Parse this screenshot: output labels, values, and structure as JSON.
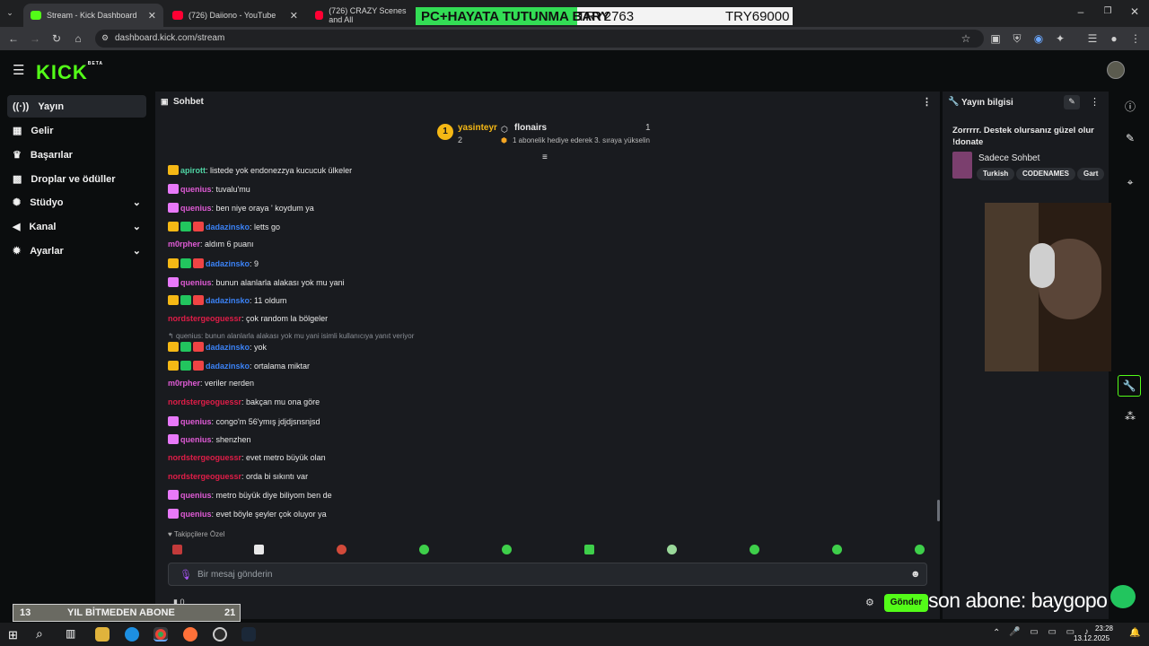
{
  "browser": {
    "tabs": [
      {
        "title": "Stream - Kick Dashboard",
        "active": true,
        "icon": "kick-icon"
      },
      {
        "title": "(726) Daiiono - YouTube",
        "active": false,
        "icon": "youtube-icon"
      },
      {
        "title": "(726) CRAZY Scenes and All",
        "active": false,
        "icon": "youtube-icon"
      }
    ],
    "url": "dashboard.kick.com/stream"
  },
  "donation_overlay": {
    "left_text": "PC+HAYATA TUTUNMA BARY",
    "mid_text": "TRY2763",
    "right_text": "TRY69000"
  },
  "header": {
    "logo": "KICK",
    "logo_sup": "BETA"
  },
  "sidebar": {
    "items": [
      {
        "label": "Yayın",
        "icon": "broadcast-icon",
        "active": true
      },
      {
        "label": "Gelir",
        "icon": "revenue-icon"
      },
      {
        "label": "Başarılar",
        "icon": "trophy-icon"
      },
      {
        "label": "Droplar ve ödüller",
        "icon": "gift-icon"
      },
      {
        "label": "Stüdyo",
        "icon": "gear-icon",
        "expandable": true
      },
      {
        "label": "Kanal",
        "icon": "megaphone-icon",
        "expandable": true
      },
      {
        "label": "Ayarlar",
        "icon": "settings-icon",
        "expandable": true
      }
    ]
  },
  "chat": {
    "title": "Sohbet",
    "pinned": {
      "rank": "1",
      "user1": "yasinteyr",
      "user1_count": "2",
      "user2": "flonairs",
      "user2_count": "1",
      "hint": "1 abonelik hediye ederek 3. sıraya yükselin"
    },
    "messages": [
      {
        "user": "apirott",
        "text": ": listede yok endonezzya kucucuk ülkeler",
        "color": "#4fd4a4"
      },
      {
        "user": "quenius",
        "text": ": tuvalu'mu",
        "color": "#e05bd6"
      },
      {
        "user": "quenius",
        "text": ": ben niye oraya ' koydum ya",
        "color": "#e05bd6"
      },
      {
        "user": "dadazinsko",
        "text": ": letts go",
        "color": "#3b82f6"
      },
      {
        "user": "m0rpher",
        "text": ": aldım 6 puanı",
        "color": "#e05bd6"
      },
      {
        "user": "dadazinsko",
        "text": ": 9",
        "color": "#3b82f6"
      },
      {
        "user": "quenius",
        "text": ": bunun alanlarla alakası yok mu yani",
        "color": "#e05bd6"
      },
      {
        "user": "dadazinsko",
        "text": ": 11 oldum",
        "color": "#3b82f6"
      },
      {
        "user": "nordstergeoguessr",
        "text": ": çok random la bölgeler",
        "color": "#e11d48"
      },
      {
        "user": "dadazinsko",
        "text": ": yok",
        "color": "#3b82f6"
      },
      {
        "user": "dadazinsko",
        "text": ": ortalama miktar",
        "color": "#3b82f6"
      },
      {
        "user": "m0rpher",
        "text": ": veriler nerden",
        "color": "#e05bd6"
      },
      {
        "user": "nordstergeoguessr",
        "text": ": bakçan mu ona göre",
        "color": "#e11d48"
      },
      {
        "user": "quenius",
        "text": ": congo'm 56'ymış jdjdjsnsnjsd",
        "color": "#e05bd6"
      },
      {
        "user": "quenius",
        "text": ": shenzhen",
        "color": "#e05bd6"
      },
      {
        "user": "nordstergeoguessr",
        "text": ": evet metro büyük olan",
        "color": "#e11d48"
      },
      {
        "user": "nordstergeoguessr",
        "text": ": orda bi sıkıntı var",
        "color": "#e11d48"
      },
      {
        "user": "quenius",
        "text": ": metro büyük diye biliyom ben de",
        "color": "#e05bd6"
      },
      {
        "user": "quenius",
        "text": ": evet böyle şeyler çok oluyor ya",
        "color": "#e05bd6"
      }
    ],
    "reply_context": "quenius: bunun alanlarla alakası yok mu yani isimli kullanıcıya yanıt veriyor",
    "followers_only": "Takipçilere Özel",
    "input_placeholder": "Bir mesaj gönderin",
    "send_label": "Gönder",
    "counter": "0"
  },
  "stream_info": {
    "title": "Yayın bilgisi",
    "stream_title": "Zorrrrr. Destek olursanız güzel olur !donate",
    "category": "Sadece Sohbet",
    "tags": [
      "Turkish",
      "CODENAMES",
      "Gart"
    ]
  },
  "bottom": {
    "goal_left": "13",
    "goal_text": "YIL BİTMEDEN ABONE",
    "goal_right": "21",
    "sub_ticker": "son abone: baygopo"
  },
  "taskbar": {
    "time": "23:28",
    "date": "13.12.2025"
  }
}
